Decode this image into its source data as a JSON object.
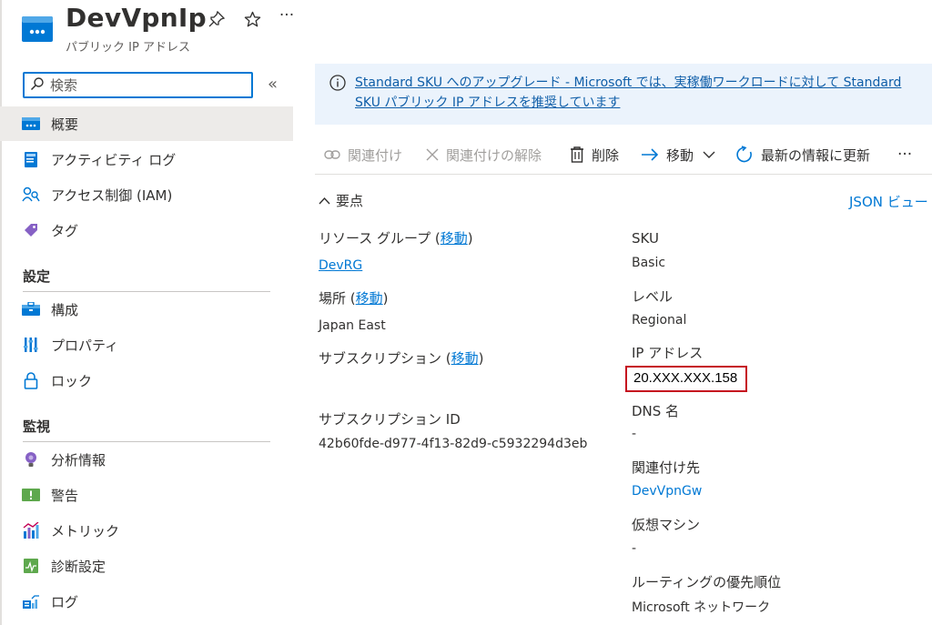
{
  "header": {
    "title": "DevVpnIp",
    "subtitle": "パブリック IP アドレス",
    "pin_icon": "pin-icon",
    "favorite_icon": "star-icon",
    "more_label": "···"
  },
  "sidebar": {
    "search_placeholder": "検索",
    "collapse_label": "«",
    "items": [
      {
        "label": "概要",
        "icon": "overview-icon"
      },
      {
        "label": "アクティビティ ログ",
        "icon": "activity-log-icon"
      },
      {
        "label": "アクセス制御 (IAM)",
        "icon": "iam-icon"
      },
      {
        "label": "タグ",
        "icon": "tag-icon"
      }
    ],
    "sections": [
      {
        "title": "設定",
        "items": [
          {
            "label": "構成",
            "icon": "configuration-icon"
          },
          {
            "label": "プロパティ",
            "icon": "properties-icon"
          },
          {
            "label": "ロック",
            "icon": "lock-icon"
          }
        ]
      },
      {
        "title": "監視",
        "items": [
          {
            "label": "分析情報",
            "icon": "insights-icon"
          },
          {
            "label": "警告",
            "icon": "alerts-icon"
          },
          {
            "label": "メトリック",
            "icon": "metrics-icon"
          },
          {
            "label": "診断設定",
            "icon": "diagnostic-settings-icon"
          },
          {
            "label": "ログ",
            "icon": "logs-icon"
          }
        ]
      }
    ]
  },
  "banner": {
    "text_line1": "Standard SKU へのアップグレード - Microsoft では、実稼働ワークロードに対して Standard",
    "text_line2": "SKU パブリック IP アドレスを推奨しています"
  },
  "toolbar": {
    "associate": "関連付け",
    "dissociate": "関連付けの解除",
    "delete": "削除",
    "move": "移動",
    "refresh": "最新の情報に更新",
    "more": "···"
  },
  "essentials": {
    "toggle_label": "要点",
    "json_view": "JSON ビュー",
    "left": {
      "resource_group_label": "リソース グループ",
      "resource_group_move": "移動",
      "resource_group_value": "DevRG",
      "location_label": "場所",
      "location_move": "移動",
      "location_value": "Japan East",
      "subscription_label": "サブスクリプション",
      "subscription_move": "移動",
      "subscription_id_label": "サブスクリプション ID",
      "subscription_id_value": "42b60fde-d977-4f13-82d9-c5932294d3eb"
    },
    "right": {
      "sku_label": "SKU",
      "sku_value": "Basic",
      "tier_label": "レベル",
      "tier_value": "Regional",
      "ip_label": "IP アドレス",
      "ip_value": "20.XXX.XXX.158",
      "dns_label": "DNS 名",
      "dns_value": "-",
      "associated_label": "関連付け先",
      "associated_value": "DevVpnGw",
      "vm_label": "仮想マシン",
      "vm_value": "-",
      "routing_label": "ルーティングの優先順位",
      "routing_value": "Microsoft ネットワーク"
    }
  },
  "colors": {
    "accent": "#0078d4",
    "highlight_box": "#c50f1f",
    "banner_bg": "#ebf3fc"
  }
}
